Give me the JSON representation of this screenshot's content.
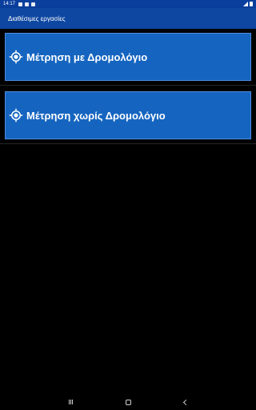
{
  "status_bar": {
    "time": "14:17",
    "icons": [
      "notification-icon",
      "shield-icon",
      "settings-icon"
    ],
    "right_icons": [
      "wifi-icon",
      "battery-icon"
    ]
  },
  "app_bar": {
    "title": "Διαθέσιμες εργασίες",
    "color": "#0d47a1"
  },
  "tasks": [
    {
      "label": "Μέτρηση με Δρομολόγιο",
      "icon": "gps-target-icon"
    },
    {
      "label": "Μέτρηση χωρίς Δρομολόγιο",
      "icon": "gps-target-icon"
    }
  ],
  "colors": {
    "button_fill": "#1565c0",
    "button_border": "#4f8be0",
    "background": "#000000"
  },
  "nav_bar": {
    "buttons": [
      "recents-icon",
      "home-icon",
      "back-icon"
    ]
  }
}
